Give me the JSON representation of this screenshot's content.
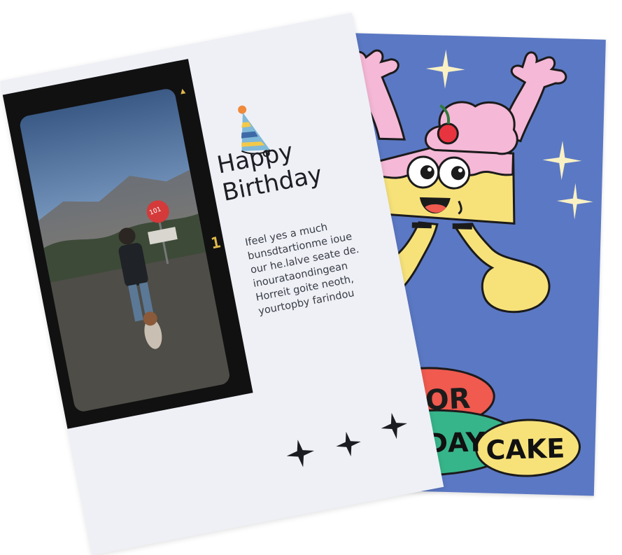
{
  "back_card": {
    "background": "#5b78c4",
    "badges": {
      "top": "FOR",
      "middle": "HDAY",
      "right": "CAKE"
    },
    "colors": {
      "cake": "#f7e27a",
      "frosting": "#f5b8d6",
      "badge_red": "#f05a4f",
      "badge_green": "#37b58a",
      "badge_yellow": "#f7e27a",
      "sparkle": "#f9f1c4"
    }
  },
  "front_card": {
    "title_line1": "Happy",
    "title_line2": "Birthday",
    "film_number": "1",
    "photo_sign": "101",
    "body_lines": [
      "Ifeel yes a much",
      "bunsdtartionme ioue",
      "our he.lalve seate de.",
      "inourataondingean",
      "Horreit goite neoth,",
      "yourtopby farindou"
    ],
    "icons": [
      "party-hat-icon",
      "sparkle-icon",
      "sparkle-icon",
      "sparkle-icon"
    ]
  }
}
